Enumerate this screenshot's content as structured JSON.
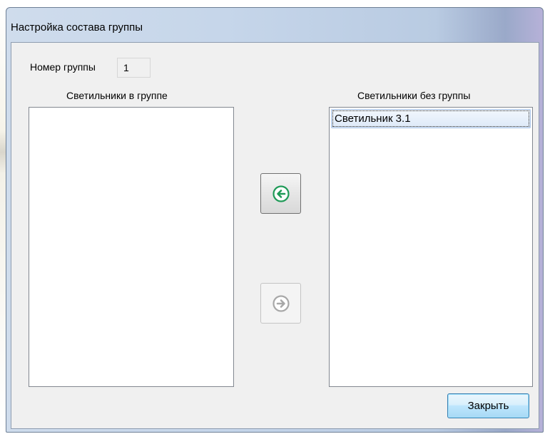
{
  "window": {
    "title": "Настройка состава группы"
  },
  "group_number": {
    "label": "Номер группы",
    "value": "1"
  },
  "left_list": {
    "header": "Светильники в группе",
    "items": []
  },
  "right_list": {
    "header": "Светильники без группы",
    "items": [
      "Светильник 3.1"
    ]
  },
  "buttons": {
    "move_left_icon": "arrow-left-circle-icon",
    "move_right_icon": "arrow-right-circle-icon",
    "close_label": "Закрыть"
  },
  "colors": {
    "arrow_active": "#1f9a57",
    "arrow_disabled": "#a8a8a8",
    "selection": "#dde9f8"
  }
}
